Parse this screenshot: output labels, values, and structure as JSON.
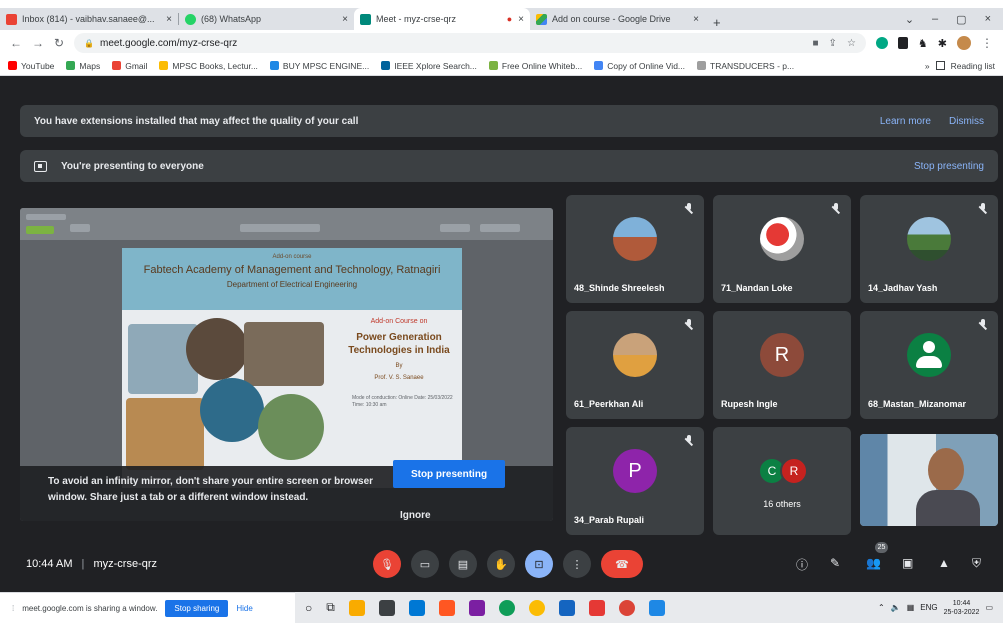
{
  "browser": {
    "tabs": [
      {
        "label": "Inbox (814) - vaibhav.sanaee@...",
        "close": "×"
      },
      {
        "label": "(68) WhatsApp",
        "close": "×"
      },
      {
        "label": "Meet - myz-crse-qrz",
        "close": "×",
        "recording": "●"
      },
      {
        "label": "Add on course - Google Drive",
        "close": "×"
      }
    ],
    "new_tab": "+",
    "window_controls": [
      "⌄",
      "–",
      "▢",
      "×"
    ],
    "url": "meet.google.com/myz-crse-qrz",
    "bookmarks": [
      "YouTube",
      "Maps",
      "Gmail",
      "MPSC Books, Lectur...",
      "BUY MPSC ENGINE...",
      "IEEE Xplore Search...",
      "Free Online Whiteb...",
      "Copy of Online Vid...",
      "TRANSDUCERS - p..."
    ],
    "reading_list": "Reading list"
  },
  "meet": {
    "extension_banner": {
      "text": "You have extensions installed that may affect the quality of your call",
      "learn_more": "Learn more",
      "dismiss": "Dismiss"
    },
    "presenting_banner": {
      "text": "You're presenting to everyone",
      "stop": "Stop presenting"
    },
    "presentation": {
      "slide_small": "Add-on course",
      "slide_title": "Fabtech Academy of Management and Technology, Ratnagiri",
      "slide_dept": "Department of Electrical Engineering",
      "slide_course_label": "Add-on Course on",
      "slide_course_name": "Power Generation Technologies in India",
      "slide_by": "By",
      "slide_author": "Prof. V. S. Sanaee",
      "slide_meta": "Mode of conduction: Online Date: 25/03/2022 Time: 10:30 am"
    },
    "mirror_warning": {
      "text": "To avoid an infinity mirror, don't share your entire screen or browser window. Share just a tab or a different window instead.",
      "stop": "Stop presenting",
      "ignore": "Ignore"
    },
    "participants": [
      {
        "name": "48_Shinde Shreelesh"
      },
      {
        "name": "71_Nandan Loke"
      },
      {
        "name": "14_Jadhav Yash"
      },
      {
        "name": "61_Peerkhan Ali"
      },
      {
        "name": "Rupesh Ingle",
        "letter": "R"
      },
      {
        "name": "68_Mastan_Mizanomar"
      },
      {
        "name": "34_Parab Rupali",
        "letter": "P"
      }
    ],
    "others": {
      "letters": [
        "C",
        "R"
      ],
      "label": "16 others"
    },
    "clock": "10:44 AM",
    "separator": "|",
    "meeting_code": "myz-crse-qrz",
    "people_count": "25"
  },
  "sharebar": {
    "text": "meet.google.com is sharing a window.",
    "stop": "Stop sharing",
    "hide": "Hide"
  },
  "taskbar": {
    "lang": "ENG",
    "time": "10:44",
    "date": "25-03-2022"
  },
  "colors": {
    "meet_bg": "#202124",
    "tile_bg": "#3c4043",
    "accent_blue": "#1a73e8",
    "end_red": "#ea4335"
  }
}
